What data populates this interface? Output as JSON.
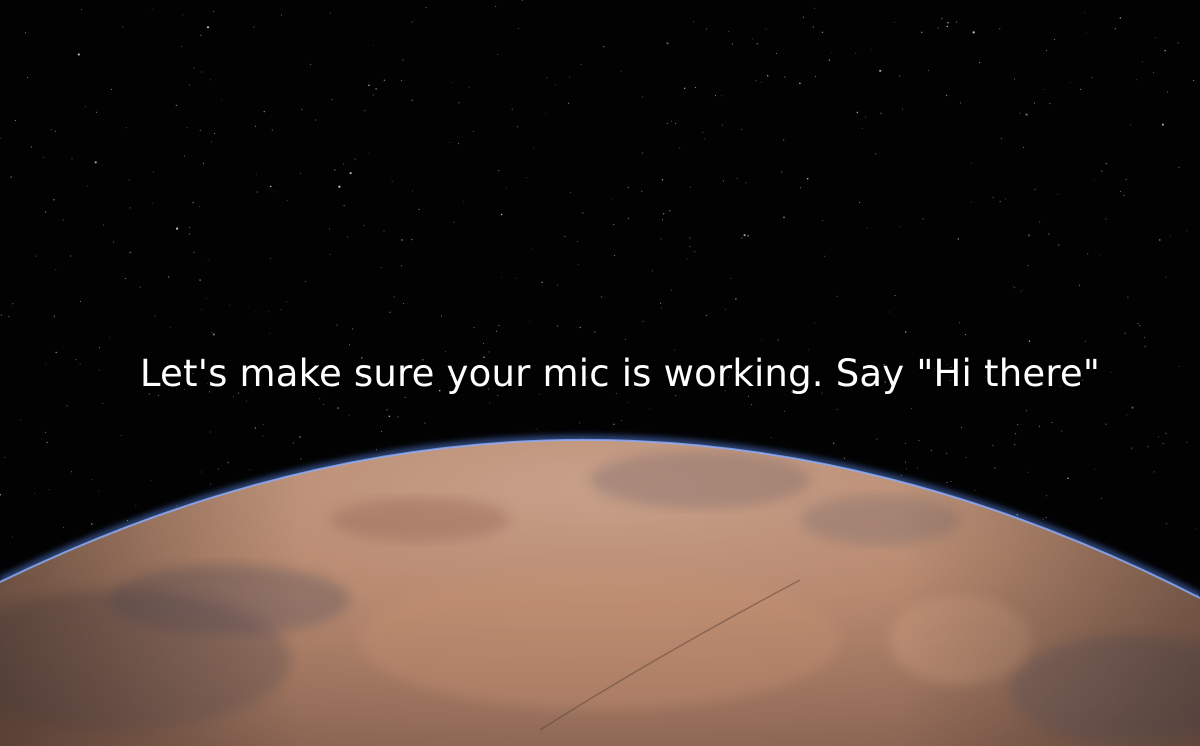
{
  "prompt": {
    "text": "Let's make sure your mic is working. Say \"Hi there\""
  },
  "scene": {
    "background": "space-starfield",
    "planet": "desert-planet-horizon",
    "colors": {
      "space": "#020203",
      "atmosphere": "#5f86d8",
      "planet_light": "#c49a82",
      "planet_dark": "#7e5c4c"
    }
  }
}
